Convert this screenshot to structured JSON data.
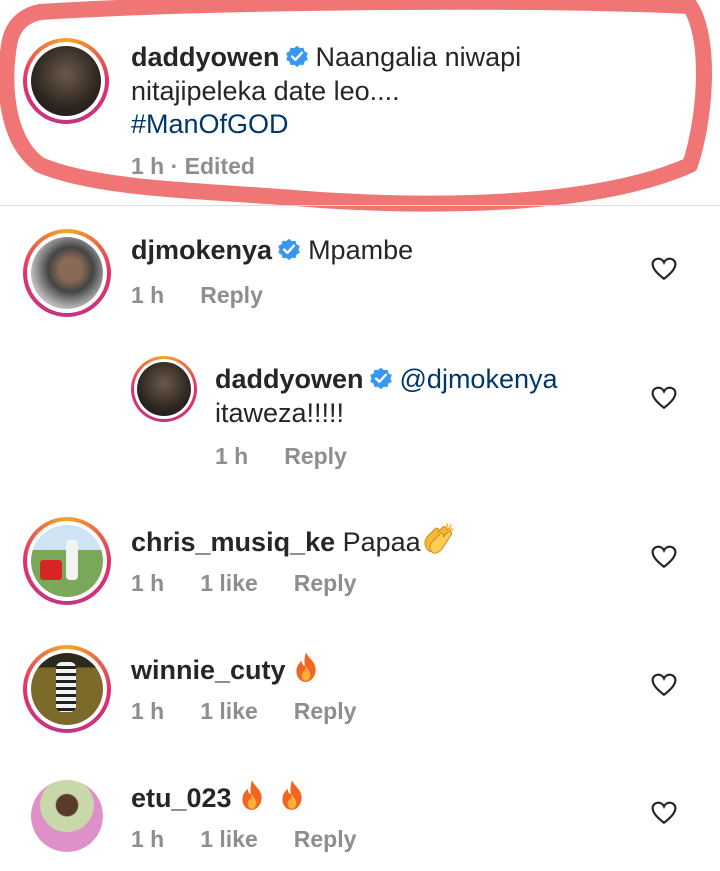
{
  "caption": {
    "username": "daddyowen",
    "text_line1": "Naangalia niwapi",
    "text_line2": "nitajipeleka date leo....",
    "hashtag": "#ManOfGOD",
    "time": "1 h · Edited",
    "annotation_color": "#f07575"
  },
  "comments": [
    {
      "username": "djmokenya",
      "text": "Mpambe",
      "time": "1 h",
      "reply": "Reply",
      "reply_item": {
        "username": "daddyowen",
        "mention": "@djmokenya",
        "text": "itaweza!!!!!",
        "time": "1 h",
        "reply": "Reply"
      }
    },
    {
      "username": "chris_musiq_ke",
      "text": "Papaa",
      "emoji": "clapping-hands",
      "time": "1 h",
      "likes": "1 like",
      "reply": "Reply"
    },
    {
      "username": "winnie_cuty",
      "emoji": "fire",
      "time": "1 h",
      "likes": "1 like",
      "reply": "Reply"
    },
    {
      "username": "etu_023",
      "emoji": "fire fire",
      "time": "1 h",
      "likes": "1 like",
      "reply": "Reply"
    }
  ],
  "colors": {
    "verified": "#3897f0",
    "link": "#00376b",
    "meta": "#8e8e8e"
  }
}
